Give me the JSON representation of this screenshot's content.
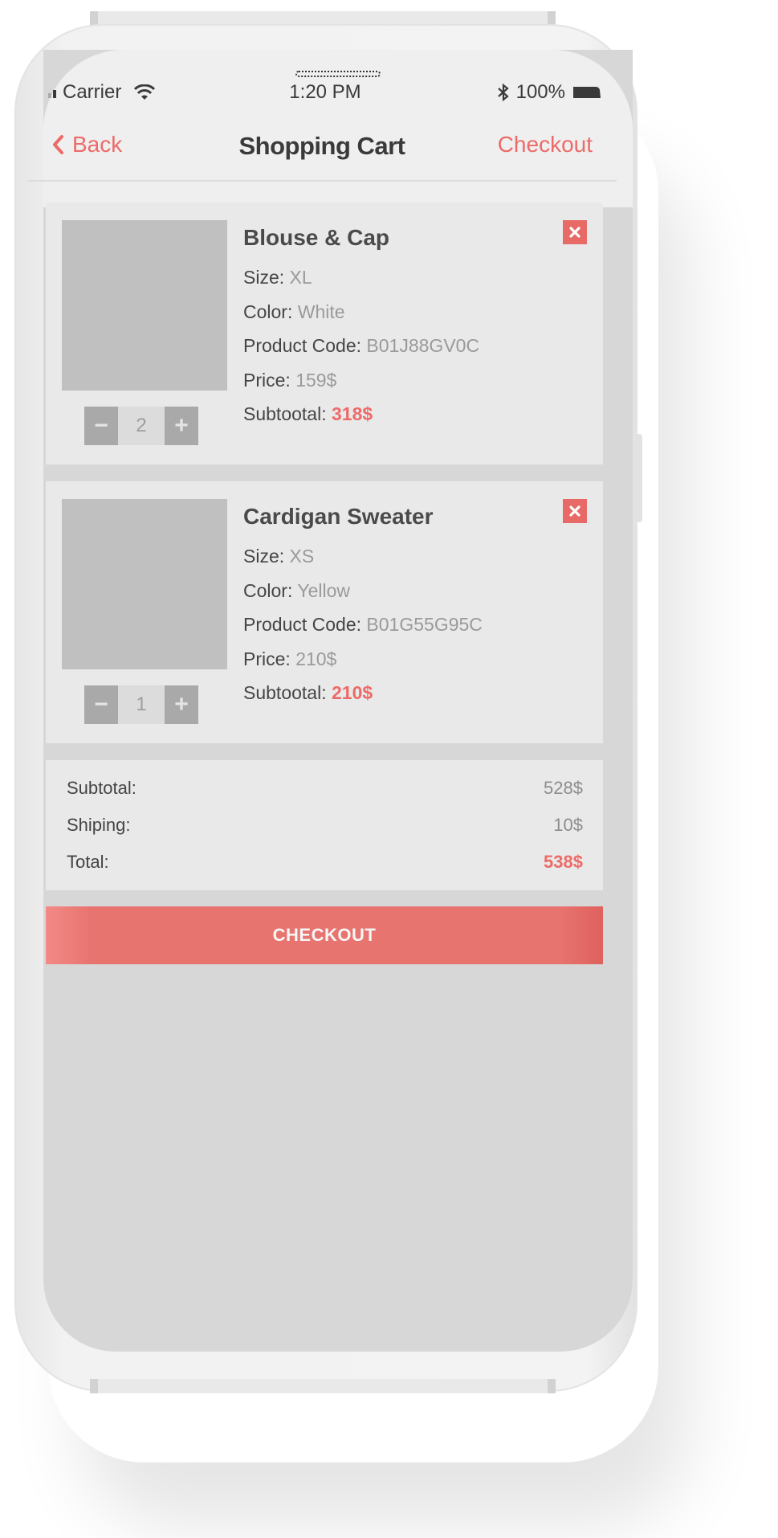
{
  "status_bar": {
    "carrier": "Carrier",
    "time": "1:20 PM",
    "battery": "100%"
  },
  "nav": {
    "back_label": "Back",
    "title": "Shopping Cart",
    "checkout_label": "Checkout"
  },
  "items": [
    {
      "name": "Blouse & Cap",
      "size_label": "Size:",
      "size": "XL",
      "color_label": "Color:",
      "color": "White",
      "code_label": "Product Code:",
      "code": "B01J88GV0C",
      "price_label": "Price:",
      "price": "159$",
      "subtotal_label": "Subtootal:",
      "subtotal": "318$",
      "quantity": "2"
    },
    {
      "name": "Cardigan Sweater",
      "size_label": "Size:",
      "size": "XS",
      "color_label": "Color:",
      "color": "Yellow",
      "code_label": "Product Code:",
      "code": "B01G55G95C",
      "price_label": "Price:",
      "price": "210$",
      "subtotal_label": "Subtootal:",
      "subtotal": "210$",
      "quantity": "1"
    }
  ],
  "stepper": {
    "minus": "−",
    "plus": "+"
  },
  "summary": {
    "subtotal_label": "Subtotal:",
    "subtotal": "528$",
    "shipping_label": "Shiping:",
    "shipping": "10$",
    "total_label": "Total:",
    "total": "538$"
  },
  "checkout_button": "CHECKOUT",
  "colors": {
    "accent": "#ec6b68",
    "screen_bg": "#d7d7d7",
    "card_bg": "#e9e9e9"
  }
}
